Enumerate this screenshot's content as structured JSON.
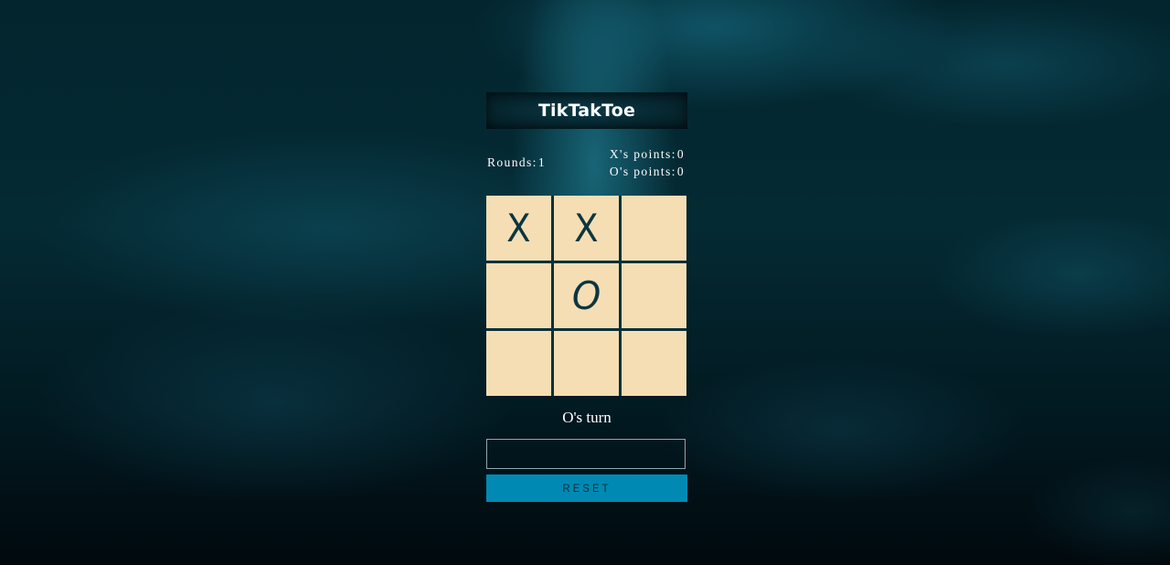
{
  "game": {
    "title": "TikTakToe",
    "rounds_label": "Rounds:",
    "rounds_value": "1",
    "x_points_label": "X's points:",
    "x_points_value": "0",
    "o_points_label": "O's points:",
    "o_points_value": "0",
    "turn_text": "O's turn"
  },
  "board": {
    "cells": [
      "X",
      "X",
      "",
      "",
      "O",
      "",
      "",
      "",
      ""
    ]
  },
  "controls": {
    "input_value": "",
    "input_placeholder": "",
    "reset_label": "RESET"
  },
  "colors": {
    "cell_bg": "#f5deb3",
    "mark_color": "#0c3540",
    "grid_line": "#06303a",
    "reset_bg": "#0089b3",
    "reset_text": "#102a33"
  }
}
